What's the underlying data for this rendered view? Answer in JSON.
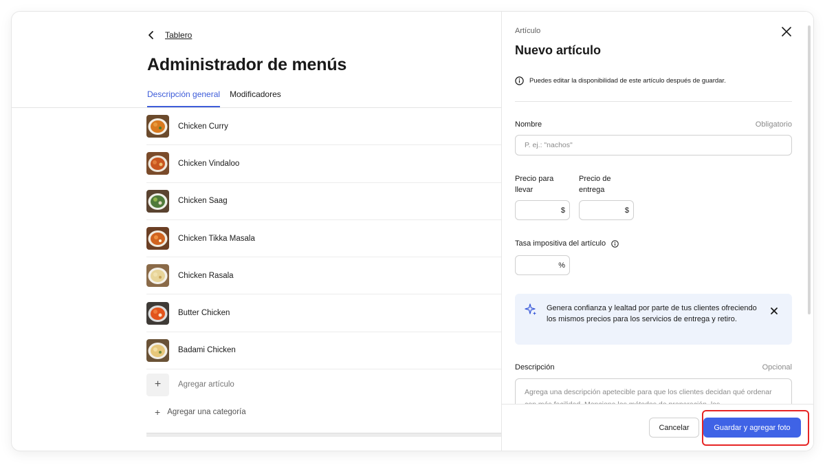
{
  "nav": {
    "back_label": "Tablero",
    "page_title": "Administrador de menús"
  },
  "tabs": [
    {
      "label": "Descripción general",
      "active": true
    },
    {
      "label": "Modificadores",
      "active": false
    }
  ],
  "menu_items": [
    {
      "name": "Chicken Curry"
    },
    {
      "name": "Chicken Vindaloo"
    },
    {
      "name": "Chicken Saag"
    },
    {
      "name": "Chicken Tikka Masala"
    },
    {
      "name": "Chicken Rasala"
    },
    {
      "name": "Butter Chicken"
    },
    {
      "name": "Badami Chicken"
    }
  ],
  "add_item_label": "Agregar artículo",
  "add_category_label": "Agregar una categoría",
  "panel": {
    "subtitle": "Artículo",
    "title": "Nuevo artículo",
    "info_text": "Puedes editar la disponibilidad de este artículo después de guardar.",
    "name_label": "Nombre",
    "name_required": "Obligatorio",
    "name_placeholder": "P. ej.: \"nachos\"",
    "pickup_price_label_1": "Precio para",
    "pickup_price_label_2": "llevar",
    "delivery_price_label_1": "Precio de",
    "delivery_price_label_2": "entrega",
    "currency_suffix": "$",
    "tax_label": "Tasa impositiva del artículo",
    "percent_suffix": "%",
    "tip_text": "Genera confianza y lealtad por parte de tus clientes ofreciendo los mismos precios para los servicios de entrega y retiro.",
    "description_label": "Descripción",
    "description_optional": "Opcional",
    "description_placeholder": "Agrega una descripción apetecible para que los clientes decidan qué ordenar con más facilidad. Menciona los métodos de preparación, los",
    "cancel_label": "Cancelar",
    "save_label": "Guardar y agregar foto"
  },
  "colors": {
    "accent": "#3c5bd9",
    "primary_button": "#3f63e6",
    "highlight": "#e62424",
    "tip_bg": "#eef3fc"
  }
}
